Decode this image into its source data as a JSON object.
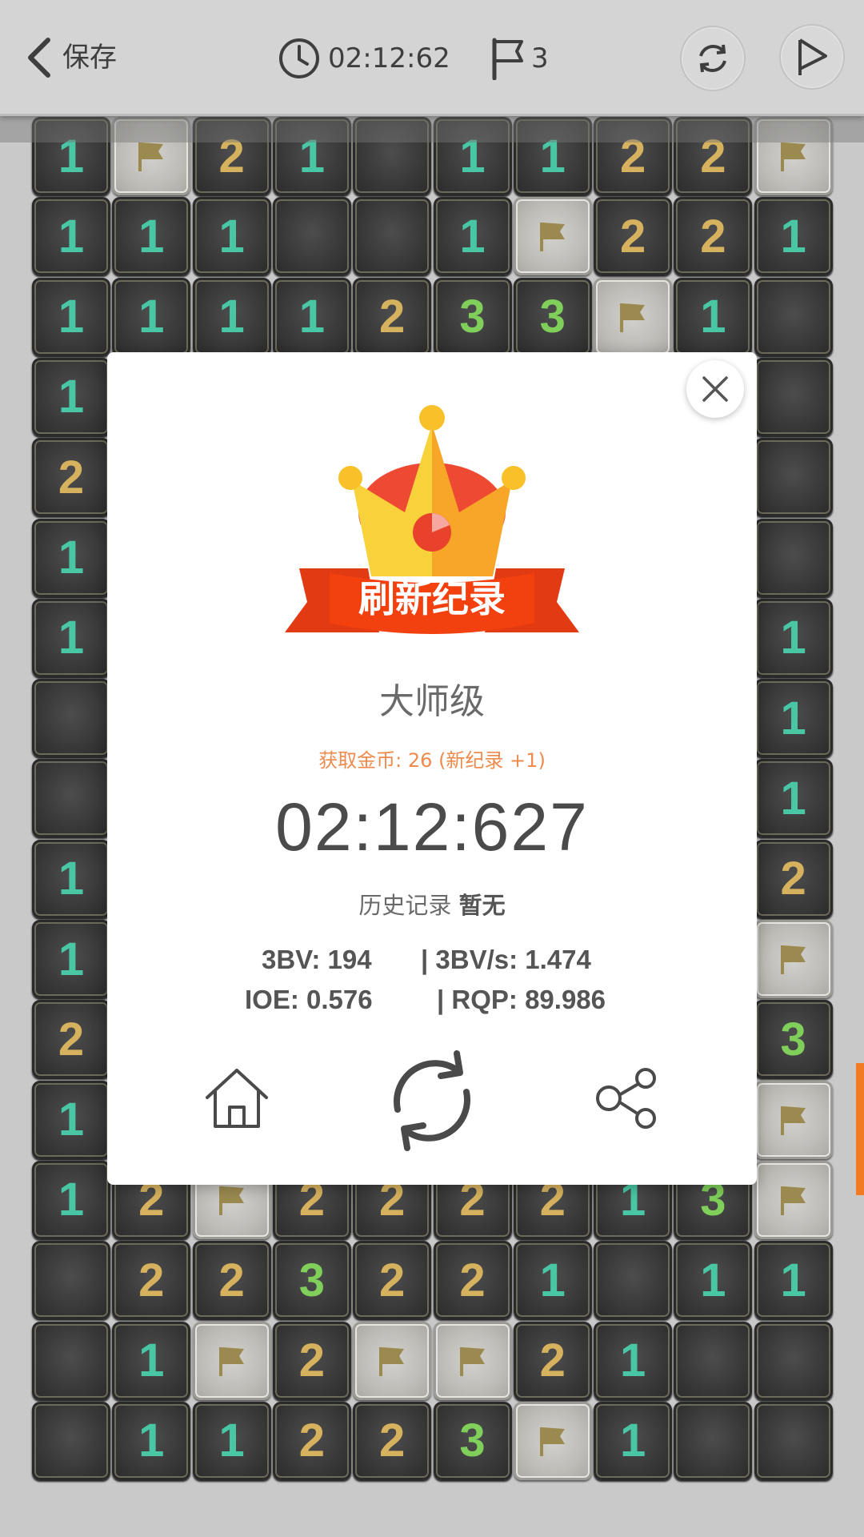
{
  "topbar": {
    "back_icon": "chevron-left-icon",
    "save_label": "保存",
    "clock_icon": "clock-icon",
    "timer": "02:12:62",
    "flag_icon": "flag-icon",
    "flag_count": "3",
    "refresh_icon": "refresh-icon",
    "play_icon": "play-icon"
  },
  "board": {
    "columns": 10,
    "visible_rows": [
      [
        "1",
        "F",
        "2",
        "1",
        "",
        "1",
        "1",
        "2",
        "2",
        "F"
      ],
      [
        "1",
        "1",
        "1",
        "",
        "",
        "1",
        "F",
        "2",
        "2",
        "1"
      ],
      [
        "1",
        "1",
        "1",
        "1",
        "2",
        "3",
        "3",
        "F",
        "1",
        ""
      ],
      [
        "1",
        "",
        "",
        "",
        "",
        "",
        "",
        "",
        "",
        ""
      ],
      [
        "2",
        "",
        "",
        "",
        "",
        "",
        "",
        "",
        "",
        ""
      ],
      [
        "1",
        "",
        "",
        "",
        "",
        "",
        "",
        "",
        "",
        ""
      ],
      [
        "1",
        "",
        "",
        "",
        "",
        "",
        "",
        "",
        "",
        "1"
      ],
      [
        "",
        "",
        "",
        "",
        "",
        "",
        "",
        "",
        "",
        "1"
      ],
      [
        "",
        "",
        "",
        "",
        "",
        "",
        "",
        "",
        "",
        "1"
      ],
      [
        "1",
        "",
        "",
        "",
        "",
        "",
        "",
        "",
        "",
        "2"
      ],
      [
        "1",
        "",
        "",
        "",
        "",
        "",
        "",
        "",
        "",
        "F"
      ],
      [
        "2",
        "",
        "",
        "",
        "",
        "",
        "",
        "",
        "",
        "3"
      ],
      [
        "1",
        "",
        "",
        "",
        "",
        "",
        "",
        "",
        "",
        "F"
      ],
      [
        "1",
        "2",
        "F",
        "2",
        "2",
        "2",
        "2",
        "1",
        "3",
        "F"
      ],
      [
        "",
        "2",
        "2",
        "3",
        "2",
        "2",
        "1",
        "",
        "1",
        "1"
      ],
      [
        "",
        "1",
        "F",
        "2",
        "F",
        "F",
        "2",
        "1",
        "",
        ""
      ],
      [
        "",
        "1",
        "1",
        "2",
        "2",
        "3",
        "F",
        "1",
        "",
        ""
      ]
    ],
    "number_colors": {
      "1": "#49c7a4",
      "2": "#d6b25e",
      "3": "#7fcf5a"
    },
    "flag_color": "#9b8a4f"
  },
  "result": {
    "banner": "刷新纪录",
    "level": "大师级",
    "coins": "获取金币: 26 (新纪录 +1)",
    "time": "02:12:627",
    "history_label": "历史记录",
    "history_value": "暂无",
    "bv3": "3BV: 194",
    "bv3s": "| 3BV/s: 1.474",
    "ioe": "IOE: 0.576",
    "rqp": "| RQP: 89.986",
    "home_icon": "home-icon",
    "restart_icon": "restart-icon",
    "share_icon": "share-icon",
    "close_icon": "close-icon"
  },
  "colors": {
    "accent": "#f07b22",
    "banner_red": "#e43a12",
    "crown_yellow": "#f7c52b"
  }
}
